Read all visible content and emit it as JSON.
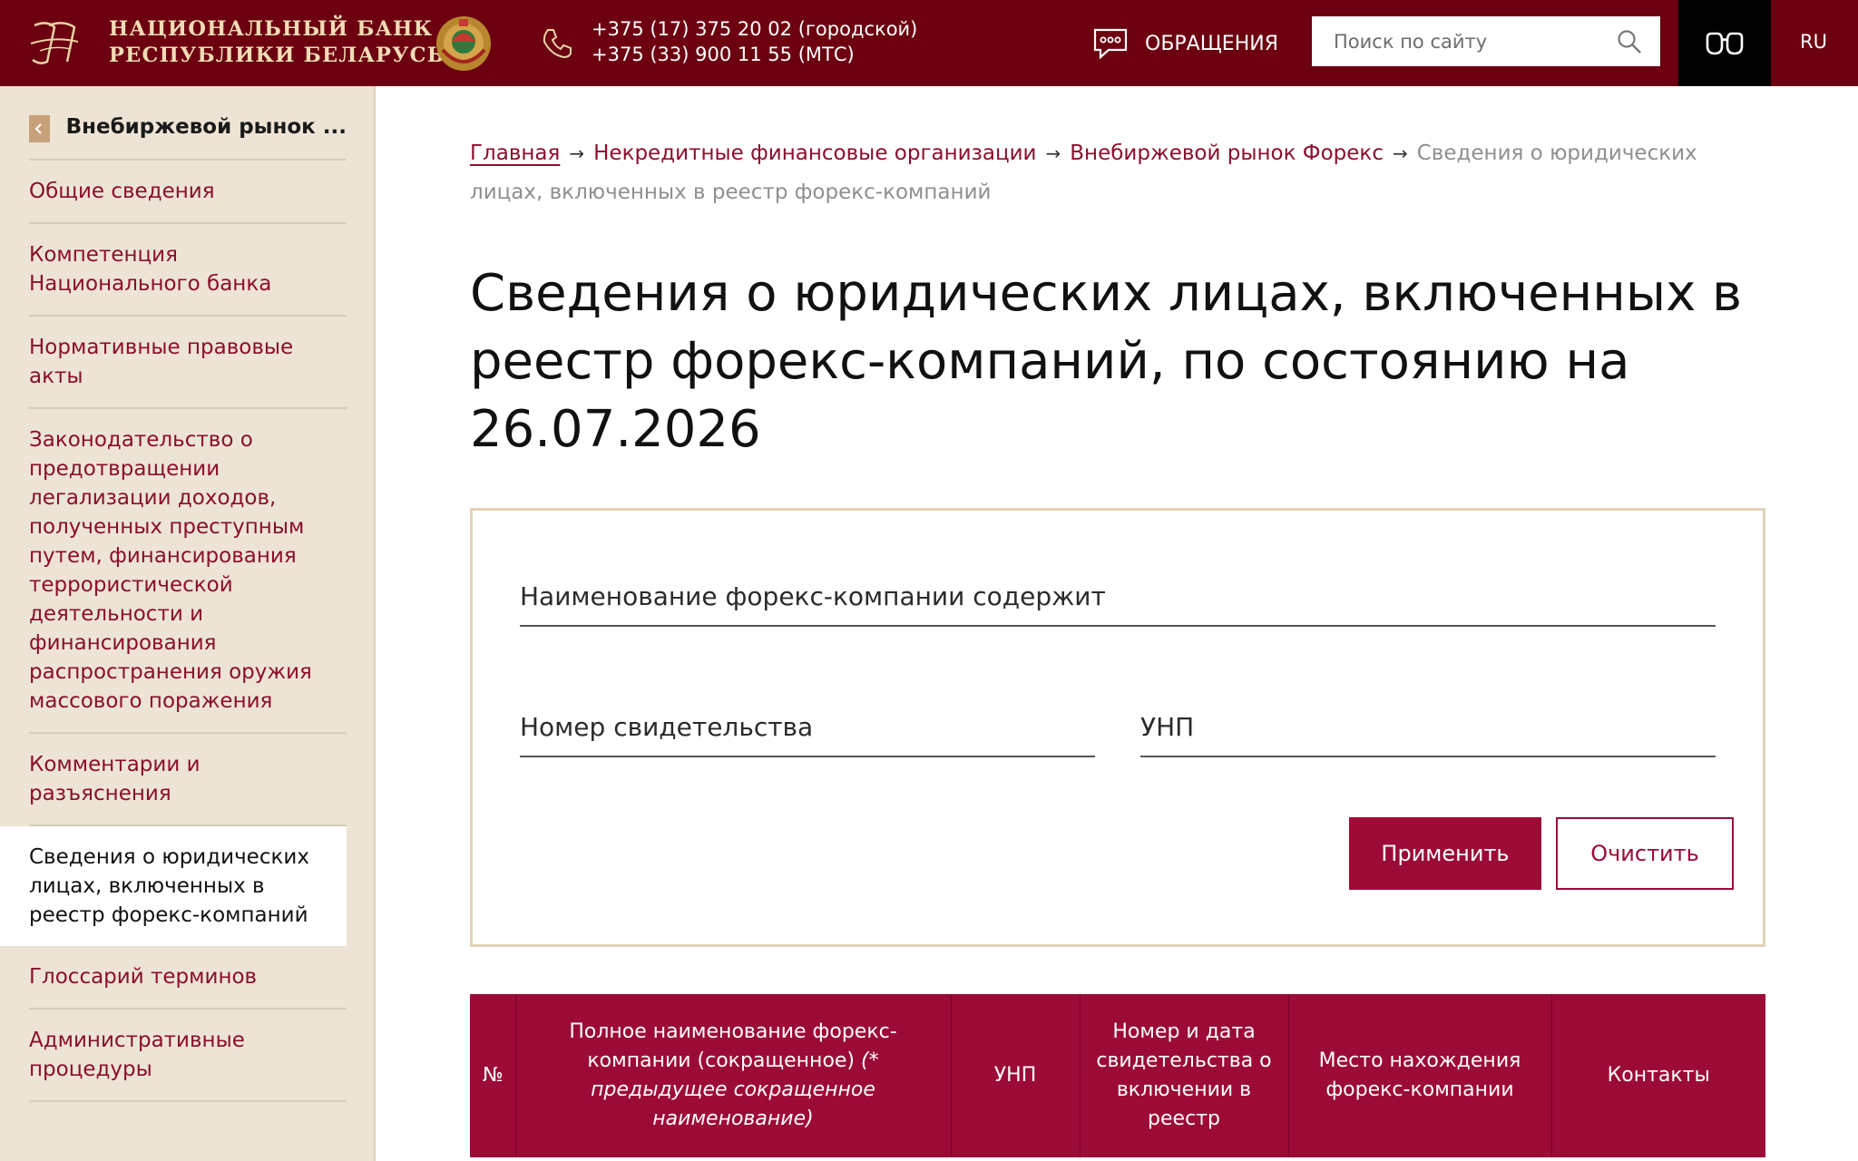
{
  "header": {
    "bank_name_line1": "НАЦИОНАЛЬНЫЙ БАНК",
    "bank_name_line2": "РЕСПУБЛИКИ БЕЛАРУСЬ",
    "phone_city": "+375 (17) 375 20 02 (городской)",
    "phone_mobile": "+375 (33) 900 11 55 (МТС)",
    "appeals_label": "ОБРАЩЕНИЯ",
    "search_placeholder": "Поиск по сайту",
    "language": "RU",
    "brand_color": "#6c0010",
    "accent_color": "#9c0a36"
  },
  "sidebar": {
    "title": "Внебиржевой рынок ...",
    "items": [
      {
        "label": "Общие сведения"
      },
      {
        "label": "Компетенция Национального банка"
      },
      {
        "label": "Нормативные правовые акты"
      },
      {
        "label": "Законодательство о предотвращении легализации доходов, полученных преступным путем, финансирования террористической деятельности и финансирования распространения оружия массового поражения"
      },
      {
        "label": "Комментарии и разъяснения"
      },
      {
        "label": "Сведения о юридических лицах, включенных в реестр форекс-компаний",
        "active": true
      },
      {
        "label": "Глоссарий терминов"
      },
      {
        "label": "Административные процедуры"
      }
    ]
  },
  "breadcrumb": {
    "home": "Главная",
    "level1": "Некредитные финансовые организации",
    "level2": "Внебиржевой рынок Форекс",
    "current": "Сведения о юридических лицах, включенных в реестр форекс-компаний",
    "separator": "→"
  },
  "page": {
    "title": "Сведения о юридических лицах, включенных в реестр форекс-компаний, по состоянию на 26.07.2026"
  },
  "filter": {
    "name_placeholder": "Наименование форекс-компании содержит",
    "cert_placeholder": "Номер свидетельства",
    "unp_placeholder": "УНП",
    "apply_label": "Применить",
    "clear_label": "Очистить"
  },
  "table": {
    "col_no": "№",
    "col_name": "Полное наименование форекс-компании (сокращенное)",
    "col_name_note": "(* предыдущее сокращенное наименование)",
    "col_unp": "УНП",
    "col_cert": "Номер и дата свидетельства о включении в реестр",
    "col_location": "Место нахождения форекс-компании",
    "col_contacts": "Контакты"
  }
}
